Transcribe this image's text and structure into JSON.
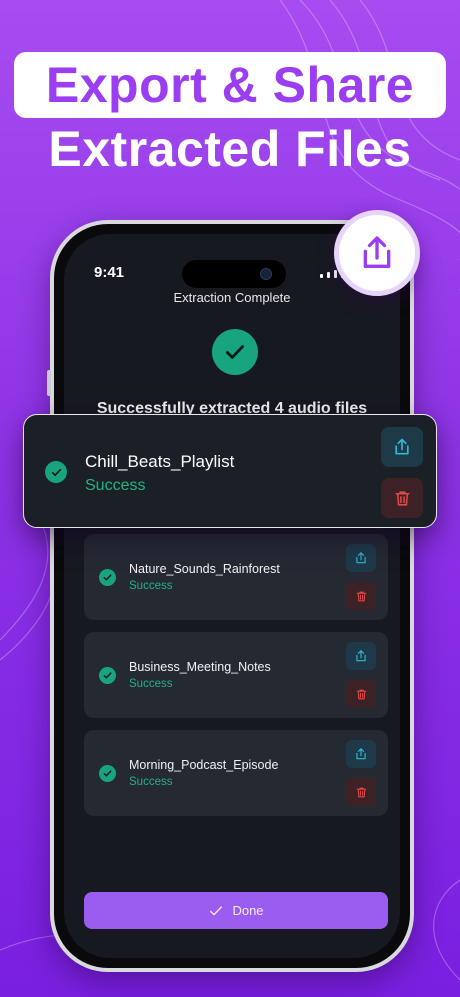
{
  "headline": {
    "line1": "Export & Share",
    "line2": "Extracted Files"
  },
  "status_bar": {
    "time": "9:41"
  },
  "screen": {
    "title": "Extraction Complete",
    "success_message": "Successfully extracted 4 audio files"
  },
  "files": [
    {
      "name": "Chill_Beats_Playlist",
      "status": "Success"
    },
    {
      "name": "Nature_Sounds_Rainforest",
      "status": "Success"
    },
    {
      "name": "Business_Meeting_Notes",
      "status": "Success"
    },
    {
      "name": "Morning_Podcast_Episode",
      "status": "Success"
    }
  ],
  "done_button": {
    "label": "Done"
  },
  "icons": {
    "share": "share-icon",
    "delete": "trash-icon",
    "check": "checkmark-icon"
  },
  "colors": {
    "background": "#9b3df0",
    "success": "#1fb487",
    "share_accent": "#2fb7d6",
    "delete_accent": "#e04848",
    "button": "#9b5cf0"
  }
}
